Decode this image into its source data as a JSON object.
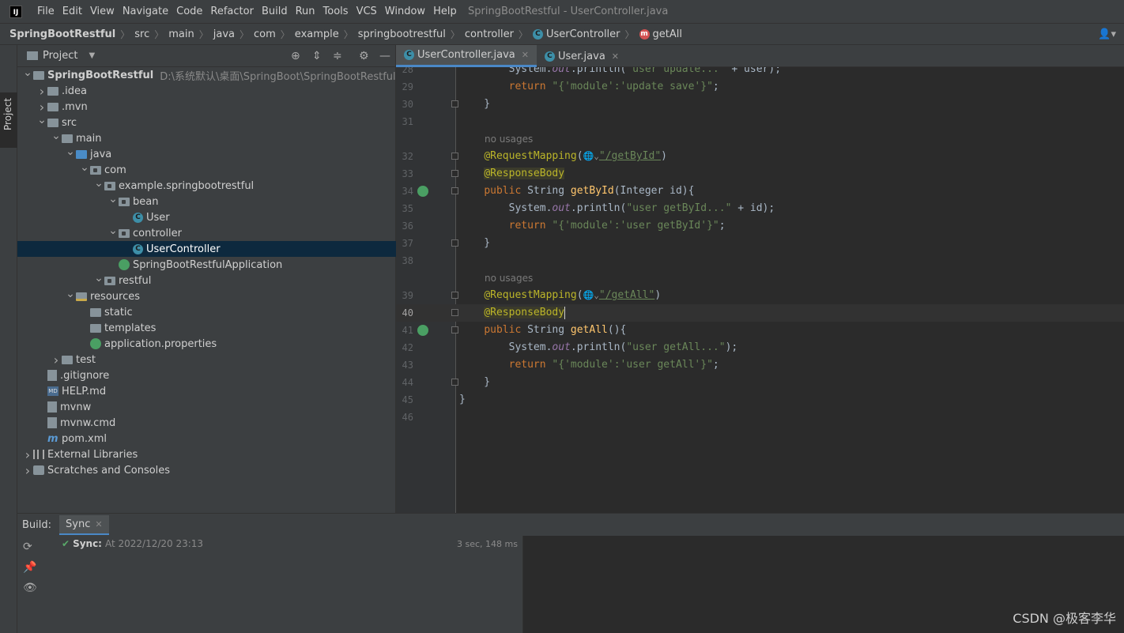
{
  "app": {
    "logo_text": "IJ",
    "window_title": "SpringBootRestful - UserController.java"
  },
  "menu": [
    "File",
    "Edit",
    "View",
    "Navigate",
    "Code",
    "Refactor",
    "Build",
    "Run",
    "Tools",
    "VCS",
    "Window",
    "Help"
  ],
  "breadcrumb": {
    "items": [
      "SpringBootRestful",
      "src",
      "main",
      "java",
      "com",
      "example",
      "springbootrestful",
      "controller"
    ],
    "class_badge": "C",
    "class_name": "UserController",
    "method_badge": "m",
    "method_name": "getAll"
  },
  "left_strip": {
    "project_tab": "Project"
  },
  "project_panel": {
    "title": "Project",
    "tree": [
      {
        "label": "SpringBootRestful",
        "path": "D:\\系统默认\\桌面\\SpringBoot\\SpringBootRestful",
        "bold": true,
        "arrow": "v",
        "icon": "folder",
        "depth": 0
      },
      {
        "label": ".idea",
        "arrow": ">",
        "icon": "folder",
        "depth": 1
      },
      {
        "label": ".mvn",
        "arrow": ">",
        "icon": "folder",
        "depth": 1
      },
      {
        "label": "src",
        "arrow": "v",
        "icon": "folder",
        "depth": 1
      },
      {
        "label": "main",
        "arrow": "v",
        "icon": "folder",
        "depth": 2
      },
      {
        "label": "java",
        "arrow": "v",
        "icon": "folder-src",
        "depth": 3
      },
      {
        "label": "com",
        "arrow": "v",
        "icon": "pkg",
        "depth": 4
      },
      {
        "label": "example.springbootrestful",
        "arrow": "v",
        "icon": "pkg",
        "depth": 5
      },
      {
        "label": "bean",
        "arrow": "v",
        "icon": "pkg",
        "depth": 6
      },
      {
        "label": "User",
        "arrow": "",
        "icon": "class",
        "depth": 7
      },
      {
        "label": "controller",
        "arrow": "v",
        "icon": "pkg",
        "depth": 6
      },
      {
        "label": "UserController",
        "arrow": "",
        "icon": "class",
        "depth": 7,
        "selected": true
      },
      {
        "label": "SpringBootRestfulApplication",
        "arrow": "",
        "icon": "spring",
        "depth": 6
      },
      {
        "label": "restful",
        "arrow": "v",
        "icon": "pkg",
        "depth": 5
      },
      {
        "label": "resources",
        "arrow": "v",
        "icon": "folder-res",
        "depth": 3
      },
      {
        "label": "static",
        "arrow": "",
        "icon": "folder",
        "depth": 4
      },
      {
        "label": "templates",
        "arrow": "",
        "icon": "folder",
        "depth": 4
      },
      {
        "label": "application.properties",
        "arrow": "",
        "icon": "spring",
        "depth": 4
      },
      {
        "label": "test",
        "arrow": ">",
        "icon": "folder",
        "depth": 2
      },
      {
        "label": ".gitignore",
        "arrow": "",
        "icon": "file",
        "depth": 1
      },
      {
        "label": "HELP.md",
        "arrow": "",
        "icon": "md",
        "depth": 1
      },
      {
        "label": "mvnw",
        "arrow": "",
        "icon": "file",
        "depth": 1
      },
      {
        "label": "mvnw.cmd",
        "arrow": "",
        "icon": "file",
        "depth": 1
      },
      {
        "label": "pom.xml",
        "arrow": "",
        "icon": "maven",
        "depth": 1
      },
      {
        "label": "External Libraries",
        "arrow": ">",
        "icon": "lib",
        "depth": 0
      },
      {
        "label": "Scratches and Consoles",
        "arrow": ">",
        "icon": "scratch",
        "depth": 0
      }
    ]
  },
  "editor_tabs": [
    {
      "label": "UserController.java",
      "badge": "C",
      "active": true
    },
    {
      "label": "User.java",
      "badge": "C",
      "active": false
    }
  ],
  "editor": {
    "current_line": "40",
    "lines": [
      {
        "ln": "28",
        "html": "        System.<span class=\"fld\">out</span>.println(<span class=\"str\">\"user update...\"</span> + user);"
      },
      {
        "ln": "29",
        "html": "        <span class=\"kw\">return</span> <span class=\"str\">\"{'module':'update save'}\"</span>;"
      },
      {
        "ln": "30",
        "html": "    }",
        "fold": true
      },
      {
        "ln": "31",
        "html": ""
      },
      {
        "hint": "no usages"
      },
      {
        "ln": "32",
        "html": "    <span class=\"ann\">@RequestMapping</span>(<span class=\"globe\">🌐⌄</span><span class=\"url\">\"/getById\"</span>)",
        "fold": true
      },
      {
        "ln": "33",
        "html": "    <span class=\"ann ann-hl\">@ResponseBody</span>",
        "fold": true
      },
      {
        "ln": "34",
        "html": "    <span class=\"kw\">public</span> String <span class=\"fn\">getById</span>(Integer id){",
        "fold": true,
        "run": true
      },
      {
        "ln": "35",
        "html": "        System.<span class=\"fld\">out</span>.println(<span class=\"str\">\"user getById...\"</span> + id);"
      },
      {
        "ln": "36",
        "html": "        <span class=\"kw\">return</span> <span class=\"str\">\"{'module':'user getById'}\"</span>;"
      },
      {
        "ln": "37",
        "html": "    }",
        "fold": true
      },
      {
        "ln": "38",
        "html": ""
      },
      {
        "hint": "no usages"
      },
      {
        "ln": "39",
        "html": "    <span class=\"ann\">@RequestMapping</span>(<span class=\"globe\">🌐⌄</span><span class=\"url\">\"/getAll\"</span>)",
        "fold": true
      },
      {
        "ln": "40",
        "html": "    <span class=\"ann ann-hl\">@ResponseBody</span><span class=\"caret\"></span>",
        "fold": true
      },
      {
        "ln": "41",
        "html": "    <span class=\"kw\">public</span> String <span class=\"fn\">getAll</span>(){",
        "fold": true,
        "run": true
      },
      {
        "ln": "42",
        "html": "        System.<span class=\"fld\">out</span>.println(<span class=\"str\">\"user getAll...\"</span>);"
      },
      {
        "ln": "43",
        "html": "        <span class=\"kw\">return</span> <span class=\"str\">\"{'module':'user getAll'}\"</span>;"
      },
      {
        "ln": "44",
        "html": "    }",
        "fold": true
      },
      {
        "ln": "45",
        "html": "}"
      },
      {
        "ln": "46",
        "html": ""
      }
    ]
  },
  "build": {
    "label": "Build:",
    "tab": "Sync",
    "status_word": "Sync:",
    "status_time": "At 2022/12/20 23:13",
    "duration": "3 sec, 148 ms"
  },
  "watermark": "CSDN @极客李华"
}
